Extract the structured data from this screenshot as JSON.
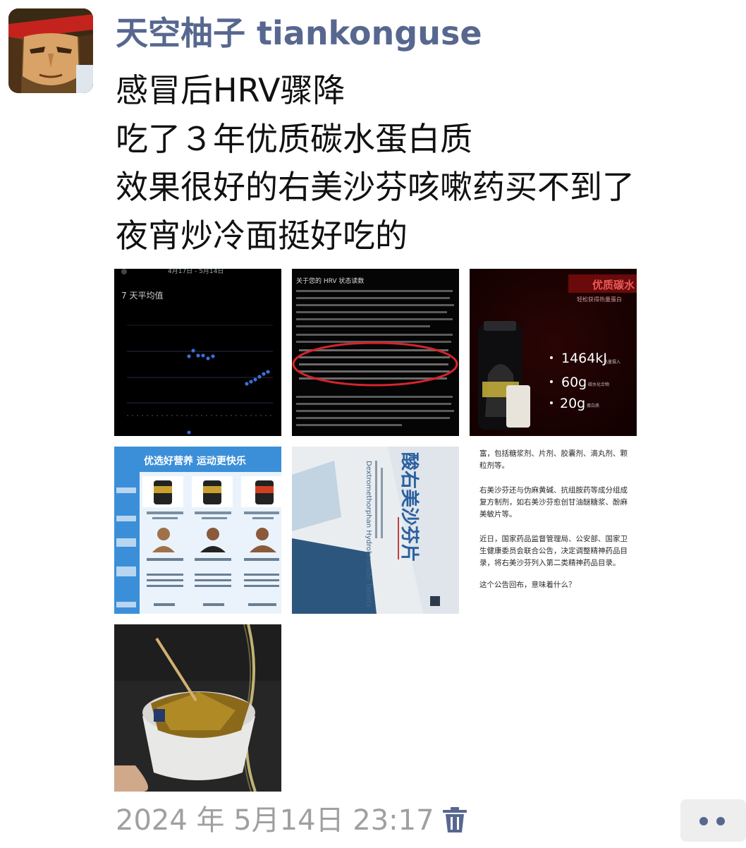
{
  "post": {
    "author": "天空柚子 tiankonguse",
    "lines": [
      "感冒后HRV骤降",
      "吃了３年优质碳水蛋白质",
      "效果很好的右美沙芬咳嗽药买不到了",
      "夜宵炒冷面挺好吃的"
    ],
    "timestamp": "2024 年 5月14日 23:17"
  },
  "images": {
    "hrv_chart": {
      "date_range": "4月17日 - 5月14日",
      "title": "7 天平均值"
    },
    "hrv_article": {
      "title": "关于您的 HRV 状态读数"
    },
    "protein_ad": {
      "headline": "优质碳水",
      "subline": "轻松获得热量蛋白",
      "energy": "1464kJ",
      "energy_unit": "热量摄入",
      "carbs": "60g",
      "carbs_unit": "碳水化合物",
      "protein": "20g",
      "protein_unit": "蛋白质"
    },
    "nutrition_banner": {
      "title": "优选好营养 运动更快乐"
    },
    "medicine_box": {
      "name": "酸右美沙芬片",
      "english": "Dextromethorphan Hydrobromide Tablets"
    },
    "news_text": {
      "p1": "富，包括糖浆剂、片剂、胶囊剂、滴丸剂、颗粒剂等。",
      "p2": "右美沙芬还与伪麻黄碱、抗组胺药等成分组成复方制剂，如右美沙芬愈创甘油醚糖浆、酚麻美敏片等。",
      "p3": "近日，国家药品监督管理局、公安部、国家卫生健康委员会联合公告，决定调整精神药品目录，将右美沙芬列入第二类精神药品目录。",
      "p4": "这个公告回布，意味着什么？"
    }
  },
  "colors": {
    "author": "#57678f",
    "timestamp": "#a0a0a0",
    "accent": "#57678f"
  },
  "icons": {
    "delete": "trash-icon",
    "more": "more-dots-icon"
  }
}
